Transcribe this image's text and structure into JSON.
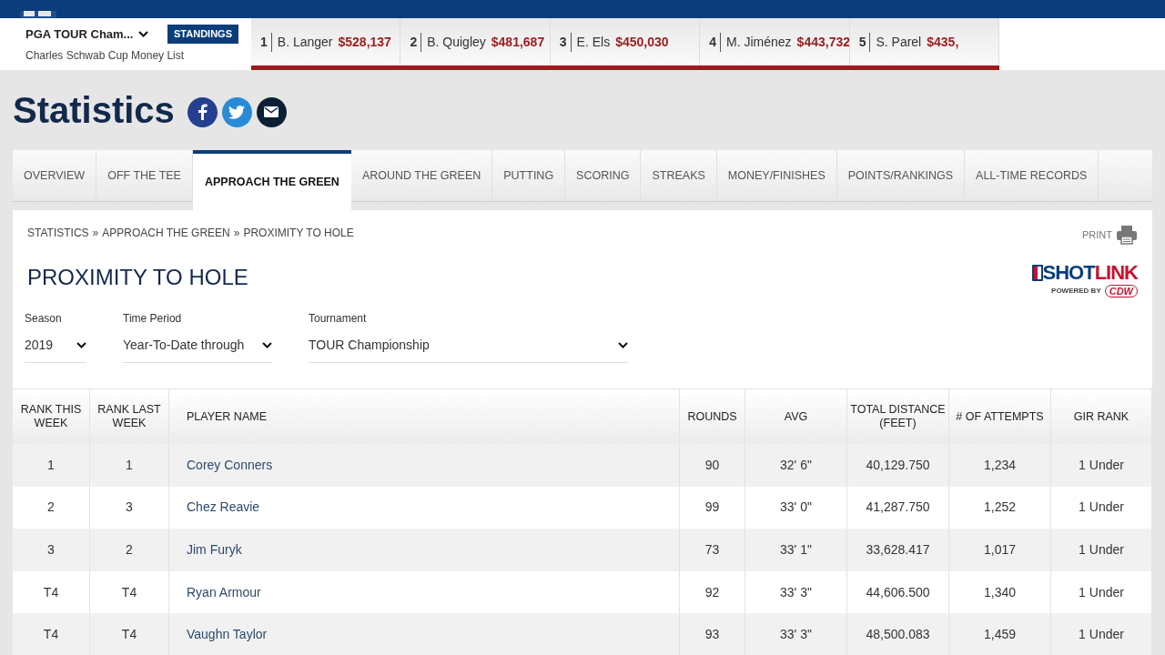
{
  "tour_selector": {
    "title": "PGA TOUR Cham...",
    "subtitle": "Charles Schwab Cup Money List",
    "button": "STANDINGS"
  },
  "ticker": [
    {
      "rank": "1",
      "name": "B. Langer",
      "amount": "$528,137"
    },
    {
      "rank": "2",
      "name": "B. Quigley",
      "amount": "$481,687"
    },
    {
      "rank": "3",
      "name": "E. Els",
      "amount": "$450,030"
    },
    {
      "rank": "4",
      "name": "M. Jiménez",
      "amount": "$443,732"
    },
    {
      "rank": "5",
      "name": "S. Parel",
      "amount": "$435,"
    }
  ],
  "page_title": "Statistics",
  "share": [
    {
      "kind": "facebook"
    },
    {
      "kind": "twitter"
    },
    {
      "kind": "email"
    }
  ],
  "tabs": [
    {
      "label": "OVERVIEW",
      "selected": false
    },
    {
      "label": "OFF THE TEE",
      "selected": false
    },
    {
      "label": "APPROACH THE GREEN",
      "selected": true
    },
    {
      "label": "AROUND THE GREEN",
      "selected": false
    },
    {
      "label": "PUTTING",
      "selected": false
    },
    {
      "label": "SCORING",
      "selected": false
    },
    {
      "label": "STREAKS",
      "selected": false
    },
    {
      "label": "MONEY/FINISHES",
      "selected": false
    },
    {
      "label": "POINTS/RANKINGS",
      "selected": false
    },
    {
      "label": "ALL-TIME RECORDS",
      "selected": false
    }
  ],
  "breadcrumb": [
    "STATISTICS",
    "»",
    "APPROACH THE GREEN",
    "»",
    "PROXIMITY TO HOLE"
  ],
  "print": "PRINT",
  "logo": {
    "word_1": "SHOT",
    "word_2": "LINK",
    "tagline": "POWERED BY",
    "sponsor": "CDW"
  },
  "stat_title": "PROXIMITY TO HOLE",
  "filters": [
    {
      "label": "Season",
      "value": "2019"
    },
    {
      "label": "Time Period",
      "value": "Year-To-Date through"
    },
    {
      "label": "Tournament",
      "value": "TOUR Championship"
    }
  ],
  "table": {
    "columns": [
      "RANK THIS WEEK",
      "RANK LAST WEEK",
      "PLAYER NAME",
      "ROUNDS",
      "AVG",
      "TOTAL DISTANCE (FEET)",
      "# OF ATTEMPTS",
      "GIR RANK"
    ],
    "rows": [
      [
        "1",
        "1",
        "Corey Conners",
        "90",
        "32' 6\"",
        "40,129.750",
        "1,234",
        "1 Under"
      ],
      [
        "2",
        "3",
        "Chez Reavie",
        "99",
        "33' 0\"",
        "41,287.750",
        "1,252",
        "1 Under"
      ],
      [
        "3",
        "2",
        "Jim Furyk",
        "73",
        "33' 1\"",
        "33,628.417",
        "1,017",
        "1 Under"
      ],
      [
        "T4",
        "T4",
        "Ryan Armour",
        "92",
        "33' 3\"",
        "44,606.500",
        "1,340",
        "1 Under"
      ],
      [
        "T4",
        "T4",
        "Vaughn Taylor",
        "93",
        "33' 3\"",
        "48,500.083",
        "1,459",
        "1 Under"
      ]
    ]
  }
}
